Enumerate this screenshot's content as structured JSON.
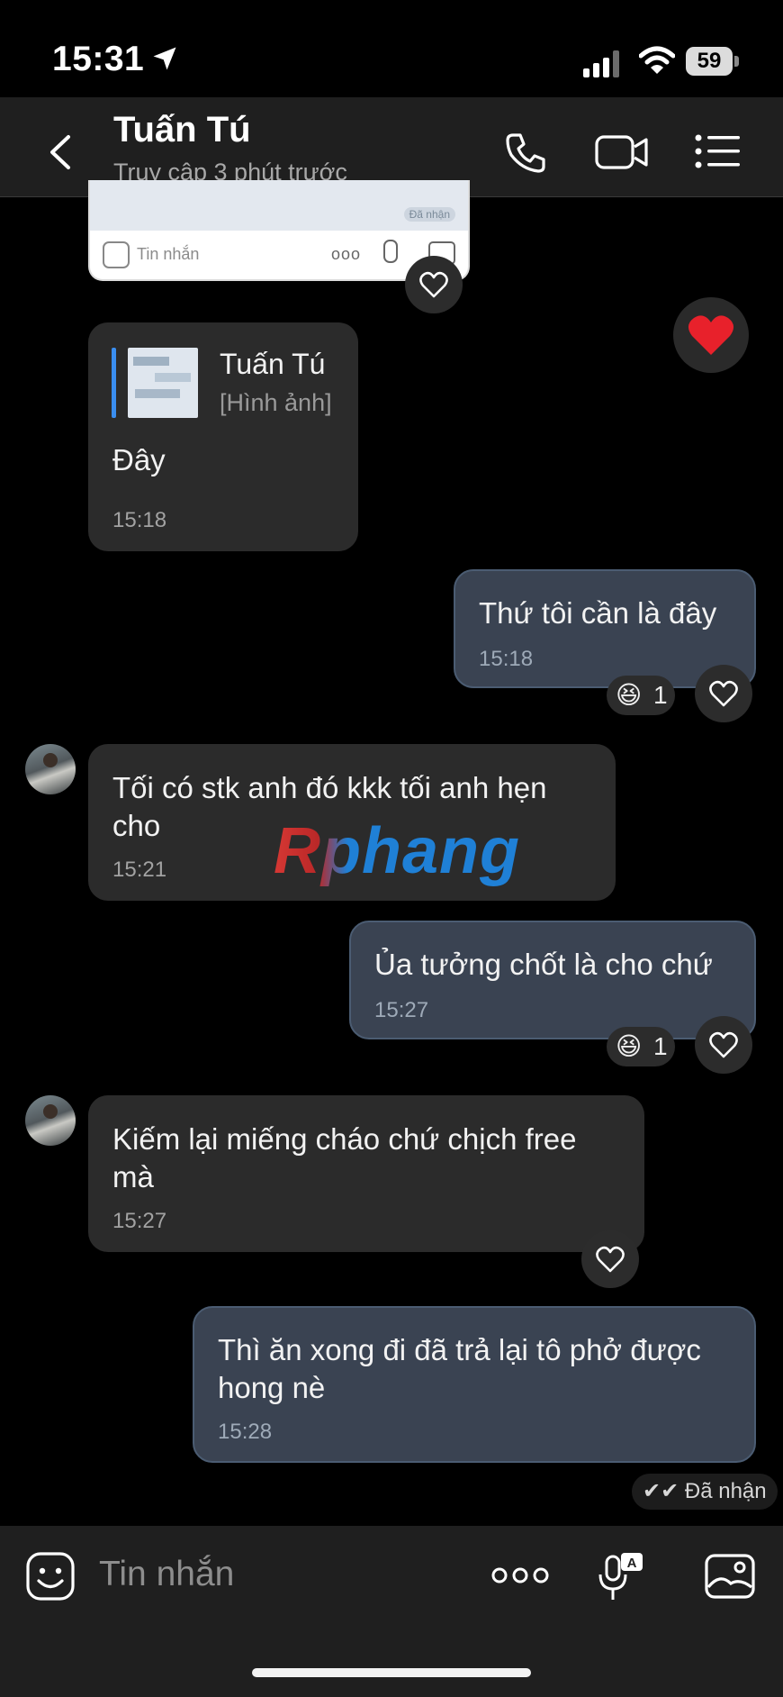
{
  "status_bar": {
    "time": "15:31",
    "battery": "59"
  },
  "header": {
    "name": "Tuấn Tú",
    "status": "Truy cập 3 phút trước"
  },
  "top_screenshot": {
    "received_label": "Đã nhận",
    "input_placeholder": "Tin nhắn",
    "more_dots": "ooo"
  },
  "messages": [
    {
      "side": "in",
      "quote": {
        "author": "Tuấn Tú",
        "type": "[Hình ảnh]"
      },
      "text": "Đây",
      "time": "15:18"
    },
    {
      "side": "out",
      "text": "Thứ tôi cần là đây",
      "time": "15:18",
      "reaction": {
        "emoji": "😆",
        "count": "1"
      }
    },
    {
      "side": "in",
      "text": "Tối có stk anh đó kkk tối anh hẹn cho",
      "time": "15:21"
    },
    {
      "side": "out",
      "text": "Ủa tưởng chốt là cho chứ",
      "time": "15:27",
      "reaction": {
        "emoji": "😆",
        "count": "1"
      }
    },
    {
      "side": "in",
      "text": "Kiếm lại miếng cháo chứ chịch free mà",
      "time": "15:27"
    },
    {
      "side": "out",
      "text": "Thì ăn xong đi đã trả lại tô phở được hong nè",
      "time": "15:28"
    }
  ],
  "delivered_label": "Đã nhận",
  "watermark": "Rphang",
  "composer": {
    "placeholder": "Tin nhắn"
  },
  "icons": {
    "back": "chevron-left-icon",
    "call": "phone-icon",
    "video": "video-camera-icon",
    "menu": "list-menu-icon",
    "heart": "heart-outline-icon",
    "big_heart": "red-heart-icon",
    "emoji": "smiley-icon",
    "more": "more-dots-icon",
    "mic": "voice-to-text-icon",
    "image": "image-icon"
  },
  "colors": {
    "outgoing_bubble": "#3a4352",
    "incoming_bubble": "#2b2b2b",
    "accent": "#3a8ef0",
    "heart_red": "#e8212b"
  }
}
